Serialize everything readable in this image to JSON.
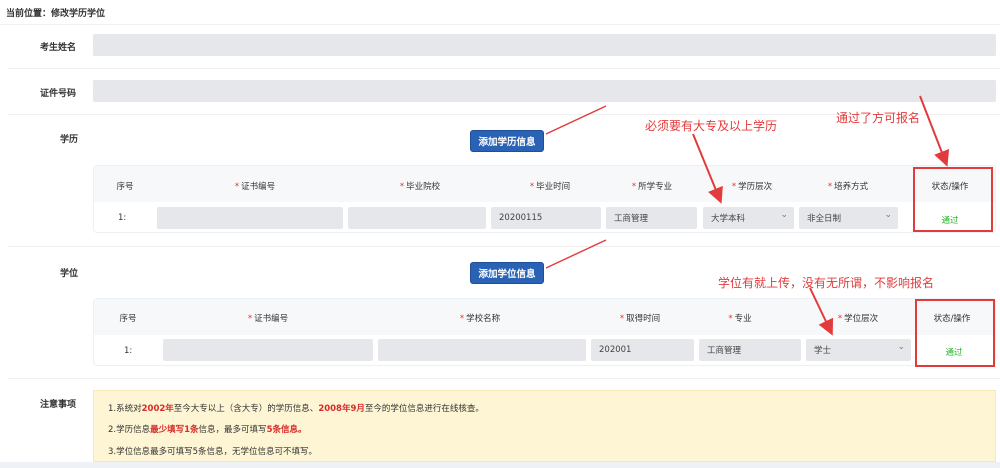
{
  "breadcrumb": "当前位置：修改学历学位",
  "labels": {
    "name": "考生姓名",
    "id_number": "证件号码",
    "education": "学历",
    "degree": "学位",
    "notice": "注意事项"
  },
  "buttons": {
    "add_education": "添加学历信息",
    "add_degree": "添加学位信息"
  },
  "education_table": {
    "headers": [
      "序号",
      "证书编号",
      "毕业院校",
      "毕业时间",
      "所学专业",
      "学历层次",
      "培养方式",
      "状态/操作"
    ],
    "required": [
      false,
      true,
      true,
      true,
      true,
      true,
      true,
      false
    ],
    "row": {
      "index": "1:",
      "cert_no": "",
      "school": "",
      "grad_time": "20200115",
      "major": "工商管理",
      "level": "大学本科",
      "mode": "非全日制",
      "status": "通过"
    }
  },
  "degree_table": {
    "headers": [
      "序号",
      "证书编号",
      "学校名称",
      "取得时间",
      "专业",
      "学位层次",
      "状态/操作"
    ],
    "required": [
      false,
      true,
      true,
      true,
      true,
      true,
      false
    ],
    "row": {
      "index": "1:",
      "cert_no": "",
      "school": "",
      "time": "202001",
      "major": "工商管理",
      "level": "学士",
      "status": "通过"
    }
  },
  "annotations": {
    "edu_requirement": "必须要有大专及以上学历",
    "pass_note": "通过了方可报名",
    "degree_note": "学位有就上传，没有无所谓，不影响报名"
  },
  "notice_lines": [
    [
      "1.系统对",
      "2002年",
      "至今大专以上（含大专）的学历信息、",
      "2008年9月",
      "至今的学位信息进行在线核查。"
    ],
    [
      "2.学历信息",
      "最少填写1条",
      "信息，最多可填写",
      "5条信息。",
      ""
    ],
    [
      "3.学位信息最多可填写5条信息，无学位信息可不填写。",
      "",
      "",
      "",
      ""
    ]
  ],
  "colors": {
    "accent_blue": "#2a62b5",
    "annotation_red": "#e23b3b",
    "pass_green": "#22b422",
    "notice_bg": "#fdf5d3"
  }
}
